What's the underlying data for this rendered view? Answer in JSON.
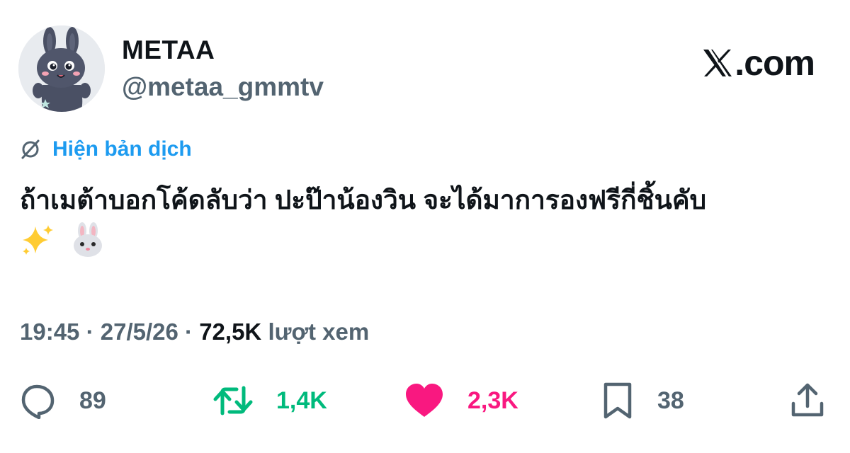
{
  "author": {
    "name": "METAA",
    "handle": "@metaa_gmmtv"
  },
  "brand": {
    "label": ".com"
  },
  "translate": {
    "label": "Hiện bản dịch"
  },
  "tweet": {
    "text": "ถ้าเมต้าบอกโค้ดลับว่า ปะป๊าน้องวิน จะได้มาการองฟรีกี่ชิ้นคับ",
    "emojis": [
      "sparkles",
      "rabbit-face"
    ]
  },
  "meta": {
    "time": "19:45",
    "separator": "·",
    "date": "27/5/26",
    "views_count": "72,5K",
    "views_label": "lượt xem"
  },
  "actions": {
    "replies": "89",
    "reposts": "1,4K",
    "likes": "2,3K",
    "bookmarks": "38"
  },
  "colors": {
    "text": "#0f1419",
    "secondary": "#536471",
    "link": "#1d9bf0",
    "repost": "#00ba7c",
    "like": "#f91880"
  }
}
